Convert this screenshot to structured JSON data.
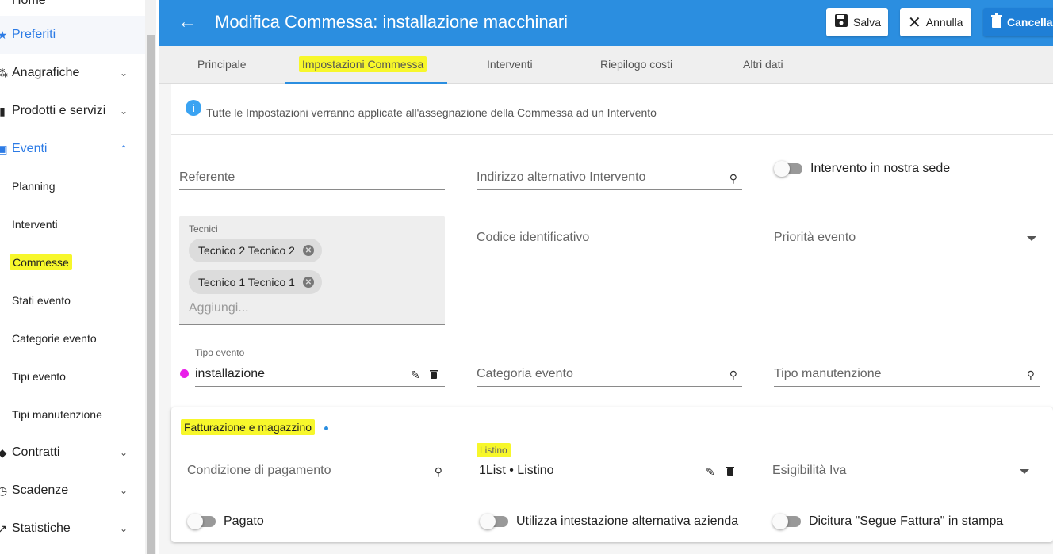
{
  "sidebar": {
    "top_partial": "Home",
    "items": [
      {
        "label": "Preferiti",
        "icon": "star-icon"
      },
      {
        "label": "Anagrafiche",
        "icon": "people-icon"
      },
      {
        "label": "Prodotti e servizi",
        "icon": "box-icon"
      },
      {
        "label": "Eventi",
        "icon": "calendar-icon"
      },
      {
        "label": "Contratti",
        "icon": "tag-icon"
      },
      {
        "label": "Scadenze",
        "icon": "clock-icon"
      },
      {
        "label": "Statistiche",
        "icon": "trend-icon"
      }
    ],
    "subitems": [
      "Planning",
      "Interventi",
      "Commesse",
      "Stati evento",
      "Categorie evento",
      "Tipi evento",
      "Tipi manutenzione"
    ]
  },
  "header": {
    "title": "Modifica Commessa: installazione macchinari",
    "save_label": "Salva",
    "cancel_label": "Annulla",
    "delete_label": "Cancella"
  },
  "tabs": [
    "Principale",
    "Impostazioni Commessa",
    "Interventi",
    "Riepilogo costi",
    "Altri dati"
  ],
  "info": "Tutte le Impostazioni verranno applicate all'assegnazione della Commessa ad un Intervento",
  "form": {
    "referente": "Referente",
    "indirizzo": "Indirizzo alternativo Intervento",
    "in_sede": "Intervento in nostra sede",
    "tecnici_label": "Tecnici",
    "tecnici": [
      "Tecnico 2 Tecnico 2",
      "Tecnico 1 Tecnico 1"
    ],
    "aggiungi": "Aggiungi...",
    "codice": "Codice identificativo",
    "priorita": "Priorità evento",
    "tipo_evento_label": "Tipo evento",
    "tipo_evento_value": "installazione",
    "tipo_evento_color": "#e91ee9",
    "categoria": "Categoria evento",
    "tipo_manutenzione": "Tipo manutenzione"
  },
  "billing": {
    "title": "Fatturazione e magazzino",
    "condizione": "Condizione di pagamento",
    "listino_label": "Listino",
    "listino_value": "1List • Listino",
    "esigibilita": "Esigibilità Iva",
    "pagato": "Pagato",
    "intestazione": "Utilizza intestazione alternativa azienda",
    "dicitura": "Dicitura \"Segue Fattura\" in stampa"
  },
  "colors": {
    "accent": "#2b8ee0",
    "highlight": "#f7f72b"
  }
}
